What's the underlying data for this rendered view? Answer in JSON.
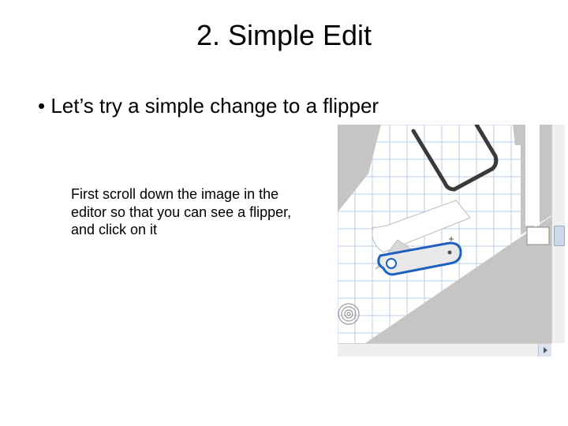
{
  "slide": {
    "title": "2. Simple Edit",
    "bullet": "Let’s try a simple change to a flipper",
    "caption": "First scroll down the image in the editor so that you can see a flipper, and click on it"
  },
  "figure": {
    "alt": "Editor screenshot showing a pinball flipper on a grid, selected with a blue outline",
    "selected_object": "flipper",
    "grid_visible": true,
    "selection_color": "#1e5fbf"
  },
  "icons": {
    "scroll_right": "chevron-right"
  }
}
